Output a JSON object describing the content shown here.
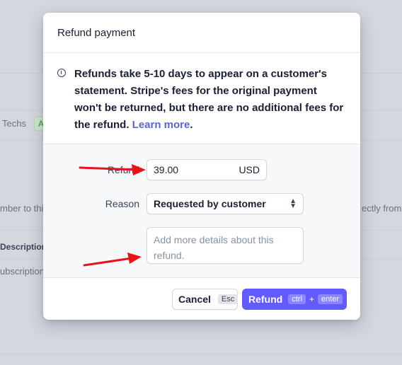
{
  "background": {
    "fragment_techs": "Techs",
    "fragment_badge": "A",
    "fragment_left_text": "mber to thi",
    "fragment_right_text": "ectly from",
    "fragment_description": "Description",
    "fragment_subscription": "ubscription"
  },
  "modal": {
    "title": "Refund payment",
    "notice": {
      "text": "Refunds take 5-10 days to appear on a customer's statement. Stripe's fees for the original payment won't be returned, but there are no additional fees for the refund.",
      "link": "Learn more",
      "suffix": "."
    },
    "form": {
      "refund_label": "Refund",
      "amount_value": "39.00",
      "currency": "USD",
      "reason_label": "Reason",
      "reason_value": "Requested by customer",
      "details_placeholder": "Add more details about this refund."
    },
    "footer": {
      "cancel_label": "Cancel",
      "cancel_shortcut": "Esc",
      "refund_label": "Refund",
      "shortcut_key1": "ctrl",
      "shortcut_plus": "+",
      "shortcut_key2": "enter"
    }
  },
  "annotation_color": "#e8121a",
  "accent_color": "#635bff"
}
